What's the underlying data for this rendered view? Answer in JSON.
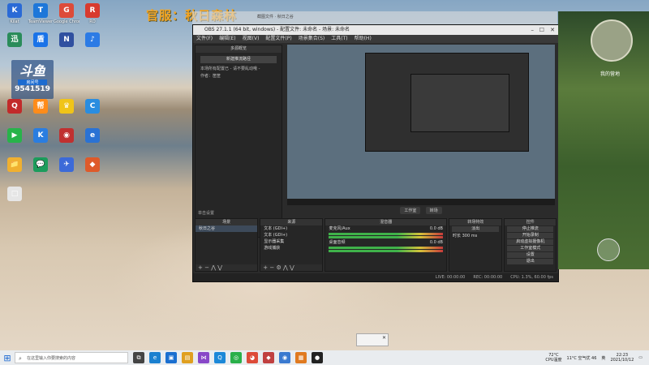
{
  "overlay": {
    "text": "官服：秋日森林"
  },
  "room_badge": {
    "logo": "斗鱼",
    "label": "房间号",
    "number": "9541519"
  },
  "desktop": {
    "icons": [
      {
        "label": "Kilat",
        "color": "#2a6ad6",
        "glyph": "K"
      },
      {
        "label": "TeamViewer",
        "color": "#1d77d9",
        "glyph": "T"
      },
      {
        "label": "Google Chrome",
        "color": "#dd4b39",
        "glyph": "G"
      },
      {
        "label": "RO",
        "color": "#d83a2f",
        "glyph": "R"
      },
      {
        "label": "",
        "color": "#2a8c5a",
        "glyph": "迅"
      },
      {
        "label": "",
        "color": "#1a73e8",
        "glyph": "盾"
      },
      {
        "label": "",
        "color": "#3050a0",
        "glyph": "N"
      },
      {
        "label": "",
        "color": "#2c7be5",
        "glyph": "♪"
      },
      {
        "label": "",
        "color": "#c22a2a",
        "glyph": "Q"
      },
      {
        "label": "",
        "color": "#ff8c1a",
        "glyph": "帮"
      },
      {
        "label": "",
        "color": "#f0c419",
        "glyph": "♛"
      },
      {
        "label": "",
        "color": "#2a8de0",
        "glyph": "C"
      },
      {
        "label": "",
        "color": "#27b34a",
        "glyph": "▶"
      },
      {
        "label": "",
        "color": "#2a7de0",
        "glyph": "K"
      },
      {
        "label": "",
        "color": "#c03030",
        "glyph": "◉"
      },
      {
        "label": "",
        "color": "#2a72d4",
        "glyph": "e"
      },
      {
        "label": "",
        "color": "#f0b030",
        "glyph": "📁"
      },
      {
        "label": "",
        "color": "#1c9c5c",
        "glyph": "💬"
      },
      {
        "label": "",
        "color": "#3c6ad8",
        "glyph": "✈"
      },
      {
        "label": "",
        "color": "#de5a2a",
        "glyph": "◆"
      },
      {
        "label": "",
        "color": "#e6e6e6",
        "glyph": "□"
      }
    ]
  },
  "top_bar": {
    "text": "截图文件 · 秋日之谷"
  },
  "obs": {
    "title": "OBS 27.1.1 (64 bit, windows) - 配置文件: 未命名 - 场景: 未命名",
    "menu": [
      "文件(F)",
      "编辑(E)",
      "视图(V)",
      "配置文件(P)",
      "场景集合(S)",
      "工具(T)",
      "帮助(H)"
    ],
    "left_panel": {
      "header": "多源概览",
      "button": "新建推流路径",
      "message_line1": "本场所有配置已 - 请不要乱动哦 -",
      "message_line2": "作者：筐筐"
    },
    "studio_mode": [
      "工作室",
      "转场"
    ],
    "left_bottom_label": "单击设置",
    "scenes": {
      "header": "场景",
      "items": [
        "秋日之谷"
      ]
    },
    "sources": {
      "header": "来源",
      "items": [
        "文本 (GDI+)",
        "文本 (GDI+)",
        "显示器采集",
        "游戏捕获"
      ]
    },
    "mixer": {
      "header": "混音器",
      "channels": [
        {
          "name": "麦克风/Aux",
          "db": "0.0 dB"
        },
        {
          "name": "桌面音频",
          "db": "0.0 dB"
        }
      ]
    },
    "transitions": {
      "header": "转场特效",
      "type": "淡出",
      "duration_label": "时长",
      "duration_value": "300 ms"
    },
    "controls": {
      "header": "控件",
      "buttons": [
        "停止推流",
        "开始录制",
        "启动虚拟摄像机",
        "工作室模式",
        "设置",
        "退出"
      ]
    },
    "status": {
      "live": "LIVE: 00:00:00",
      "rec": "REC: 00:00:00",
      "cpu": "CPU: 1.3%, 60.00 fps"
    }
  },
  "game": {
    "label": "我的营地"
  },
  "taskbar": {
    "search_placeholder": "在这里输入你要搜索的内容",
    "apps": [
      {
        "name": "task-view",
        "color": "#444",
        "glyph": "⧉"
      },
      {
        "name": "edge",
        "color": "#1a80d0",
        "glyph": "e"
      },
      {
        "name": "store",
        "color": "#1a6fd0",
        "glyph": "▣"
      },
      {
        "name": "explorer",
        "color": "#e0a020",
        "glyph": "▤"
      },
      {
        "name": "vs",
        "color": "#8848c8",
        "glyph": "⋈"
      },
      {
        "name": "qq",
        "color": "#1c88d8",
        "glyph": "Q"
      },
      {
        "name": "wechat",
        "color": "#2ab04a",
        "glyph": "◎"
      },
      {
        "name": "chrome",
        "color": "#dd4b39",
        "glyph": "◕"
      },
      {
        "name": "game",
        "color": "#c04040",
        "glyph": "◆"
      },
      {
        "name": "app",
        "color": "#3a7ad0",
        "glyph": "◉"
      },
      {
        "name": "file",
        "color": "#e07a20",
        "glyph": "▦"
      },
      {
        "name": "obs",
        "color": "#222",
        "glyph": "●"
      }
    ],
    "temp": "72°C",
    "temp_label": "CPU温度",
    "weather": "11°C 空气优 46",
    "time": "22:23",
    "date": "2021/10/12",
    "lang": "英"
  }
}
